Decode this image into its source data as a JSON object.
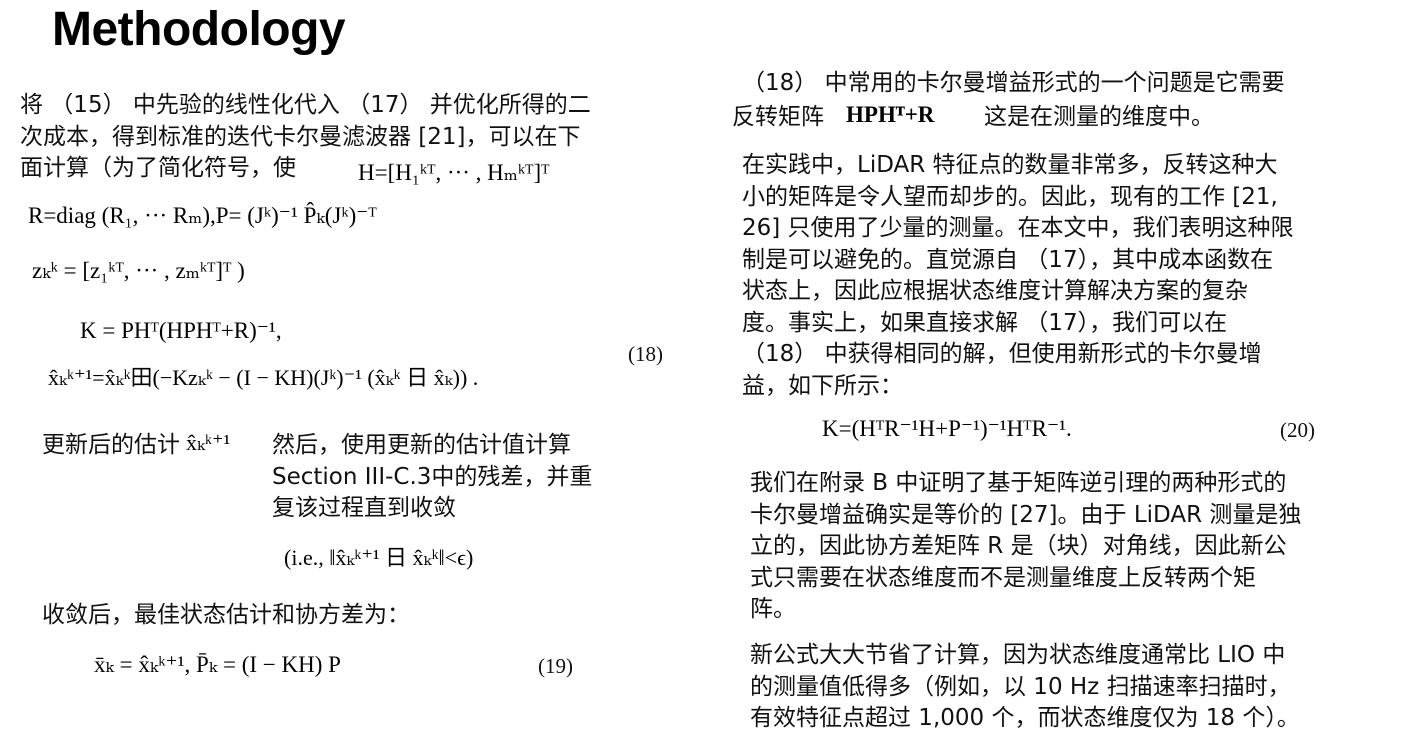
{
  "title": "Methodology",
  "left": {
    "p1": [
      "将 （15） 中先验的线性化代入 （17） 并优化所得的二",
      "次成本，得到标准的迭代卡尔曼滤波器 [21]，可以在下",
      "面计算（为了简化符号，使"
    ],
    "eq_H": "H=[H₁ᵏᵀ, ··· , Hₘᵏᵀ]ᵀ",
    "eq_R": "R=diag (R₁, ··· Rₘ),P= (Jᵏ)⁻¹ P̂ₖ(Jᵏ)⁻ᵀ",
    "eq_z": "zₖᵏ = [z₁ᵏᵀ, ··· , zₘᵏᵀ]ᵀ )",
    "eq18_line1": "K = PHᵀ(HPHᵀ+R)⁻¹,",
    "eq18_line2": "x̂ₖᵏ⁺¹=x̂ₖᵏ田(−Kzₖᵏ − (I − KH)(Jᵏ)⁻¹ (x̂ₖᵏ 日 x̂ₖ)) .",
    "eq18_no": "(18)",
    "p2_start": "更新后的估计",
    "p2_sym": "x̂ₖᵏ⁺¹",
    "p2": [
      "然后，使用更新的估计值计算",
      "Section III-C.3中的残差，并重",
      "复该过程直到收敛"
    ],
    "conv": "(i.e., ‖x̂ₖᵏ⁺¹ 日 x̂ₖᵏ‖<ϵ)",
    "p3": "收敛后，最佳状态估计和协方差为：",
    "eq19": "x̄ₖ = x̂ₖᵏ⁺¹,  P̄ₖ = (I − KH) P",
    "eq19_no": "(19)"
  },
  "right": {
    "p1": [
      "（18） 中常用的卡尔曼增益形式的一个问题是它需要",
      "反转矩阵"
    ],
    "p1_math": "HPHᵀ+R",
    "p1_end": "这是在测量的维度中。",
    "p2": [
      "在实践中，LiDAR 特征点的数量非常多，反转这种大",
      "小的矩阵是令人望而却步的。因此，现有的工作 [21,",
      "26] 只使用了少量的测量。在本文中，我们表明这种限",
      "制是可以避免的。直觉源自 （17），其中成本函数在",
      "状态上，因此应根据状态维度计算解决方案的复杂",
      "度。事实上，如果直接求解 （17），我们可以在",
      "（18） 中获得相同的解，但使用新形式的卡尔曼增",
      "益，如下所示："
    ],
    "eq20": "K=(HᵀR⁻¹H+P⁻¹)⁻¹HᵀR⁻¹.",
    "eq20_no": "(20)",
    "p3": [
      "我们在附录 B 中证明了基于矩阵逆引理的两种形式的",
      "卡尔曼增益确实是等价的 [27]。由于 LiDAR 测量是独",
      "立的，因此协方差矩阵 R 是（块）对角线，因此新公",
      "式只需要在状态维度而不是测量维度上反转两个矩",
      "阵。"
    ],
    "p4": [
      "新公式大大节省了计算，因为状态维度通常比 LIO 中",
      "的测量值低得多（例如，以 10 Hz 扫描速率扫描时，",
      "有效特征点超过 1,000 个，而状态维度仅为 18 个）。"
    ]
  }
}
